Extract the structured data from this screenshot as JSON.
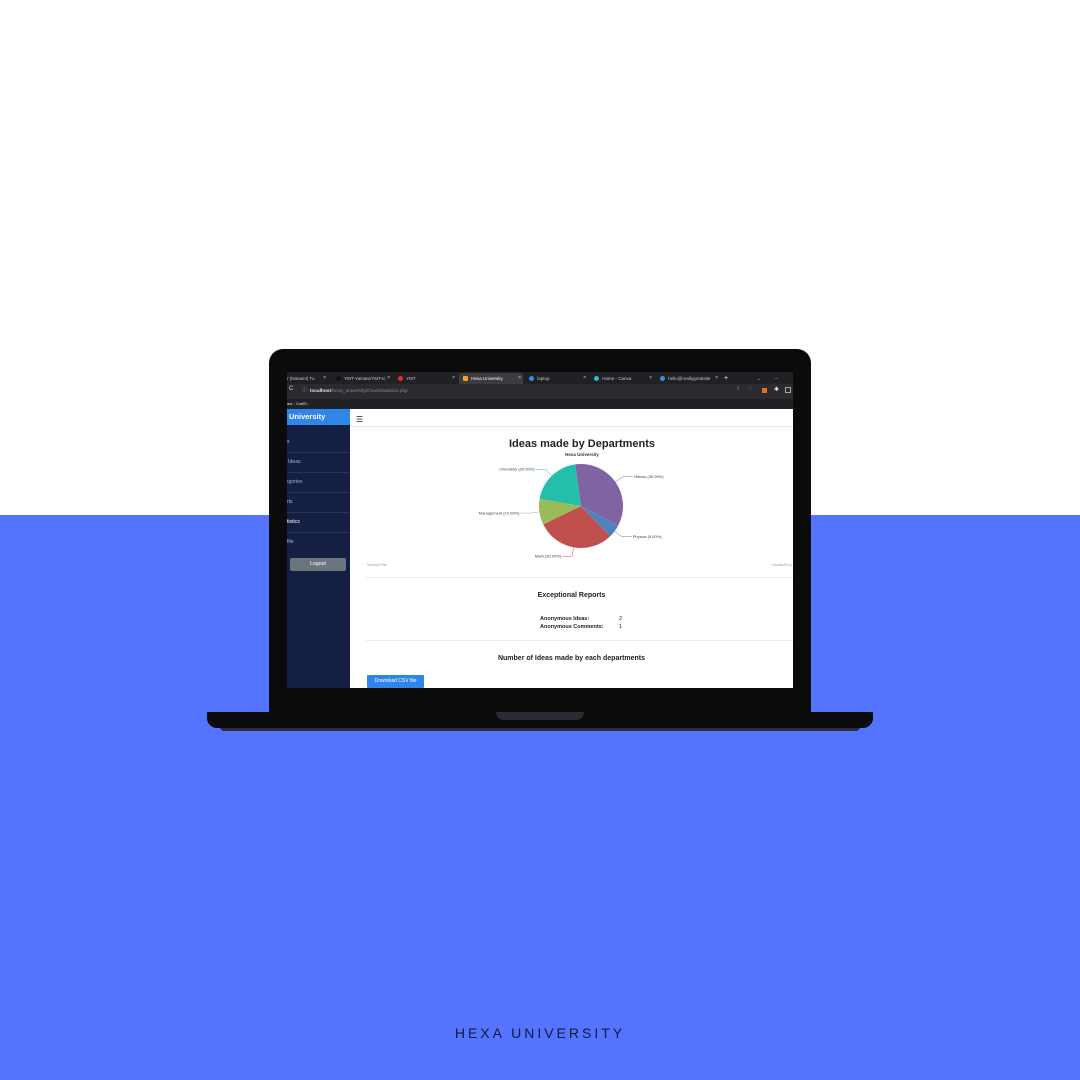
{
  "caption": "HEXA UNIVERSITY",
  "colors": {
    "background_top": "#ffffff",
    "background_bottom": "#5473ff",
    "sidebar": "#141f43",
    "accent": "#2f86e8"
  },
  "browser": {
    "tabs": [
      {
        "label": "r (Nanami) Tu",
        "icon": "close-icon"
      },
      {
        "label": "YMT-Yamato/YMT-Ic",
        "icon": "github-icon"
      },
      {
        "label": "YMT",
        "icon": "youtube-icon"
      },
      {
        "label": "Hexa University",
        "icon": "site-icon",
        "active": true
      },
      {
        "label": "laptop",
        "icon": "globe-icon"
      },
      {
        "label": "Home - Canva",
        "icon": "canva-icon"
      },
      {
        "label": "hello@reallygreatsite",
        "icon": "globe-icon"
      }
    ],
    "url_host": "localhost",
    "url_path": "/hexa_university/Chart/statistics.php",
    "bookmark": "act - Craft'f..."
  },
  "sidebar": {
    "title": "University",
    "items": [
      {
        "label": "as",
        "active": false
      },
      {
        "label": "Ideas",
        "active": false
      },
      {
        "label": "tegories",
        "active": false
      },
      {
        "label": "orts",
        "active": false
      },
      {
        "label": "atistics",
        "active": true
      },
      {
        "label": "ofile",
        "active": false
      }
    ],
    "logout_label": "Logout"
  },
  "chart_data": {
    "type": "pie",
    "title": "Ideas made by Departments",
    "subtitle": "Hexa University",
    "slices": [
      {
        "label": "History (35.00%)",
        "value": 35,
        "color": "#8064a2"
      },
      {
        "label": "Physics (5.00%)",
        "value": 5,
        "color": "#4f81bd"
      },
      {
        "label": "Math (30.00%)",
        "value": 30,
        "color": "#c0504d"
      },
      {
        "label": "Management (10.00%)",
        "value": 10,
        "color": "#9bbb59"
      },
      {
        "label": "Chemistry (20.00%)",
        "value": 20,
        "color": "#23bfaa"
      }
    ],
    "footer_left": "Semasti Fish",
    "footer_right": "CanvasJS.co"
  },
  "reports": {
    "title": "Exceptional Reports",
    "rows": [
      {
        "label": "Anonymous Ideas:",
        "value": "2"
      },
      {
        "label": "Anonymous Comments:",
        "value": "1"
      }
    ]
  },
  "departments_section": {
    "title": "Number of Ideas made by each departments",
    "download_label": "Download CSV file"
  }
}
